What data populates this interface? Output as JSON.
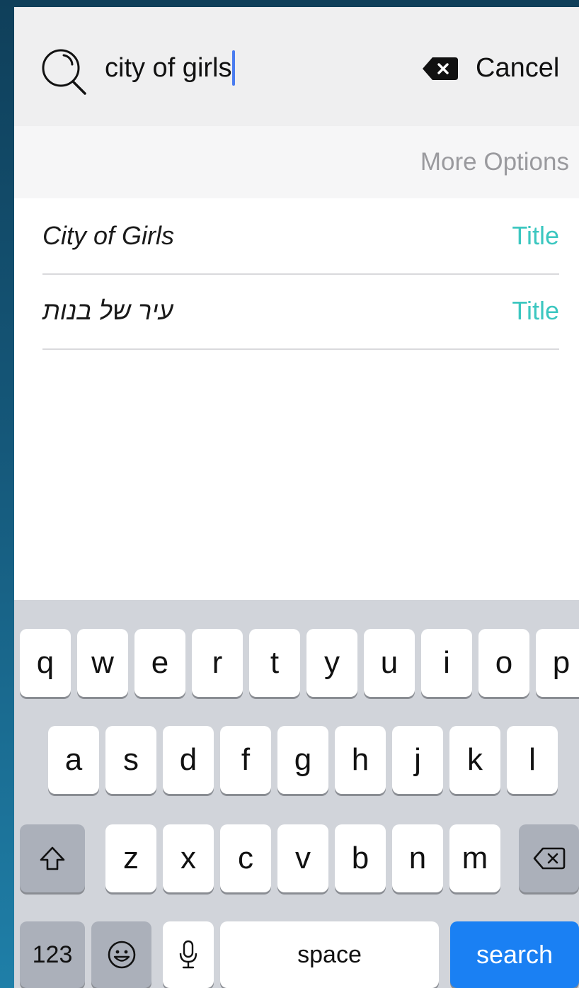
{
  "search": {
    "query": "city of girls",
    "cancel_label": "Cancel"
  },
  "more_options": {
    "label": "More Options"
  },
  "results": [
    {
      "title": "City of Girls",
      "type": "Title"
    },
    {
      "title": "עיר של בנות",
      "type": "Title"
    }
  ],
  "colors": {
    "accent_teal": "#3cc7c0",
    "caret_blue": "#4a7cf0",
    "search_key_blue": "#1a80f3"
  },
  "keyboard": {
    "row1": [
      "q",
      "w",
      "e",
      "r",
      "t",
      "y",
      "u",
      "i",
      "o",
      "p"
    ],
    "row2": [
      "a",
      "s",
      "d",
      "f",
      "g",
      "h",
      "j",
      "k",
      "l"
    ],
    "row3": [
      "z",
      "x",
      "c",
      "v",
      "b",
      "n",
      "m"
    ],
    "shift_icon": "shift-arrow-icon",
    "backspace_icon": "delete-backward-icon",
    "numbers_label": "123",
    "emoji_icon": "emoji-face-icon",
    "mic_icon": "microphone-icon",
    "space_label": "space",
    "search_label": "search"
  }
}
